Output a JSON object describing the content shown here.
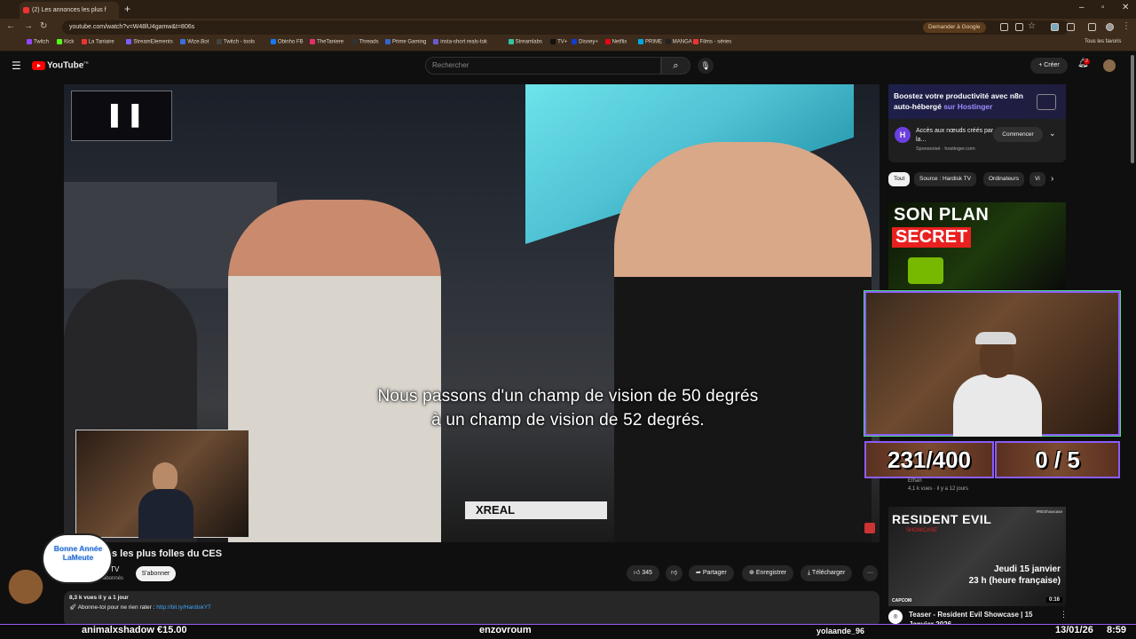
{
  "browser": {
    "tab_title": "(2) Les annonces les plus f",
    "new_tab": "+",
    "url": "youtube.com/watch?v=W48lU4gamw&t=806s",
    "ask_google": "Demander à Google",
    "bookmarks": [
      "Twitch",
      "Kick",
      "La Taniaire",
      "StreamElements",
      "Wize.Bot",
      "Twitch - tools",
      "Obinho FB",
      "TheTaniere",
      "Threads",
      "Prime Gaming",
      "insta-short reals-tok",
      "Streamlabs",
      "TV+",
      "Disney+",
      "Netflix",
      "PRIME",
      "MANGA",
      "Films - séries"
    ],
    "all_bookmarks": "Tous les favoris",
    "bookmark_colors": [
      "#9146ff",
      "#53fc18",
      "#e33",
      "#7a5cff",
      "#3b6fd8",
      "#444",
      "#1877f2",
      "#e1306c",
      "#333",
      "#3366cc",
      "#6a5acd",
      "#31c3a2",
      "#111",
      "#113ccf",
      "#e50914",
      "#00a8e1",
      "#222",
      "#e33"
    ]
  },
  "youtube": {
    "logo": "YouTube",
    "logo_sup": "FR",
    "search_placeholder": "Rechercher",
    "create": "+ Créer",
    "notif_count": "2"
  },
  "video": {
    "subtitle_line1": "Nous passons d'un champ de vision de 50 degrés",
    "subtitle_line2": "à un champ de vision de 52 degrés.",
    "title": "s les plus folles du CES",
    "channel": "k TV",
    "subs": "65,7 k abonnés",
    "subscribe": "S'abonner",
    "likes": "345",
    "share": "Partager",
    "save": "Enregistrer",
    "download": "Télécharger",
    "views_date": "8,3 k vues  il y a 1 jour",
    "desc_text": "Abonne-toi pour ne rien rater : ",
    "desc_link": "http://bit.ly/HardiskYT"
  },
  "overlay": {
    "bubble": "Bonne Année LaMeute",
    "counter_left": "231/400",
    "counter_right": "0 / 5",
    "ticker": [
      {
        "text": "animalxshadow €15.00"
      },
      {
        "text": "enzovroum"
      },
      {
        "text": "yolaande_96"
      }
    ],
    "date": "13/01/26",
    "time": "8:59"
  },
  "sidebar": {
    "ad": {
      "headline_a": "Boostez votre productivité avec n8n auto-hébergé ",
      "headline_b": "sur Hostinger",
      "text": "Accès aux nœuds créés par la...",
      "sponsored": "Sponsorisé · hostinger.com",
      "cta": "Commencer"
    },
    "chips": [
      "Tout",
      "Source : Hardisk TV",
      "Ordinateurs",
      "Vi"
    ],
    "thumb1_line1": "SON PLAN",
    "thumb1_line2": "SECRET",
    "item1_channel": "Ethan",
    "item1_meta": "4,1 k vues · il y a 12 jours",
    "thumb2": {
      "brand": "RESIDENT EVIL",
      "sub": "SHOWCASE",
      "tag": "#REShowcase",
      "date_line1": "Jeudi 15 janvier",
      "date_line2": "23 h (heure française)",
      "duration": "0:16",
      "caption": "CAPCOM"
    },
    "item2_title": "Teaser - Resident Evil Showcase | 15 Janvier 2026"
  }
}
